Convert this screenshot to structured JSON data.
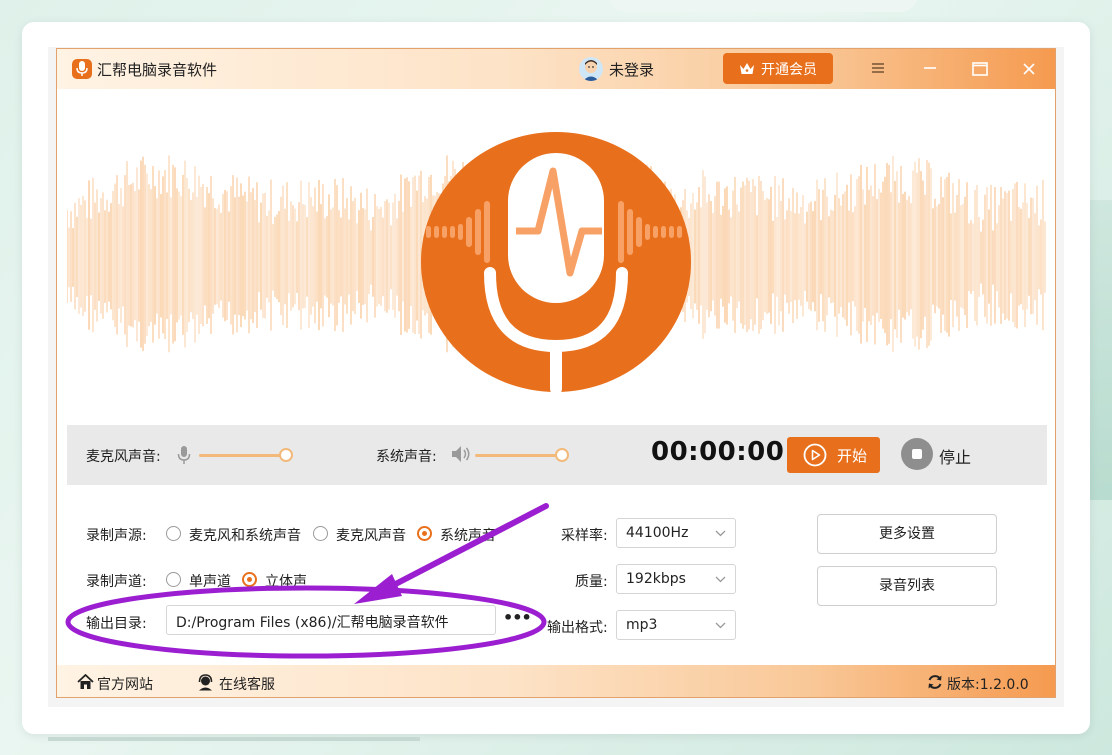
{
  "app": {
    "title": "汇帮电脑录音软件",
    "user_label": "未登录",
    "vip_button": "开通会员"
  },
  "controls": {
    "mic_label": "麦克风声音:",
    "mic_level": 0.95,
    "system_label": "系统声音:",
    "system_level": 0.95,
    "timer": "00:00:00",
    "start_label": "开始",
    "stop_label": "停止"
  },
  "settings": {
    "source_label": "录制声源:",
    "source_options": [
      "麦克风和系统声音",
      "麦克风声音",
      "系统声音"
    ],
    "source_selected": 2,
    "channel_label": "录制声道:",
    "channel_options": [
      "单声道",
      "立体声"
    ],
    "channel_selected": 1,
    "output_dir_label": "输出目录:",
    "output_dir_value": "D:/Program Files (x86)/汇帮电脑录音软件",
    "more_button": "•••",
    "sample_rate_label": "采样率:",
    "sample_rate_value": "44100Hz",
    "quality_label": "质量:",
    "quality_value": "192kbps",
    "format_label": "输出格式:",
    "format_value": "mp3",
    "more_settings_button": "更多设置",
    "record_list_button": "录音列表"
  },
  "footer": {
    "website": "官方网站",
    "support": "在线客服",
    "version": "版本:1.2.0.0"
  },
  "colors": {
    "accent": "#e8701c",
    "wave": "#f9c99a",
    "annotation": "#9b1fd1"
  }
}
